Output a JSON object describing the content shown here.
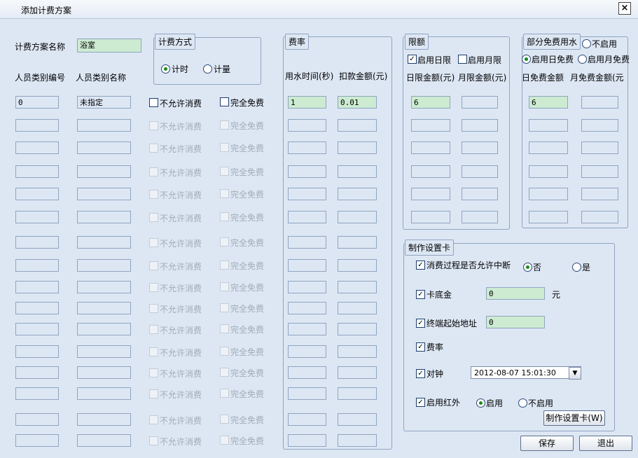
{
  "window": {
    "title": "添加计费方案",
    "close_symbol": "×"
  },
  "plan": {
    "name_label": "计费方案名称",
    "name_value": "浴室"
  },
  "billing_mode": {
    "legend": "计费方式",
    "timed": "计时",
    "metered": "计量"
  },
  "personnel": {
    "code_header": "人员类别编号",
    "name_header": "人员类别名称",
    "first_code": "0",
    "first_name": "未指定",
    "no_consume": "不允许消费",
    "free": "完全免费"
  },
  "rate": {
    "legend": "费率",
    "time_header": "用水时间(秒)",
    "amount_header": "扣款金额(元)",
    "first_time": "1",
    "first_amount": "0.01"
  },
  "limit": {
    "legend": "限额",
    "daily_enable": "启用日限",
    "monthly_enable": "启用月限",
    "daily_header": "日限金额(元)",
    "monthly_header": "月限金额(元)",
    "first_daily": "6"
  },
  "partial_free": {
    "legend": "部分免费用水",
    "disable": "不启用",
    "daily_free": "启用日免费",
    "monthly_free": "启用月免费",
    "daily_header": "日免费金额",
    "monthly_header": "月免费金额(元",
    "first_daily": "6"
  },
  "card": {
    "legend": "制作设置卡",
    "interrupt_label": "消费过程是否允许中断",
    "no": "否",
    "yes": "是",
    "deposit_label": "卡底金",
    "deposit_value": "0",
    "deposit_unit": "元",
    "terminal_label": "终端起始地址",
    "terminal_value": "0",
    "rate_label": "费率",
    "clock_label": "对钟",
    "clock_value": "2012-08-07 15:01:30",
    "infrared_label": "启用红外",
    "infrared_on": "启用",
    "infrared_off": "不启用",
    "make_button": "制作设置卡(W)"
  },
  "actions": {
    "save": "保存",
    "exit": "退出"
  },
  "checkmark": "✓",
  "dropdown_arrow": "▼"
}
